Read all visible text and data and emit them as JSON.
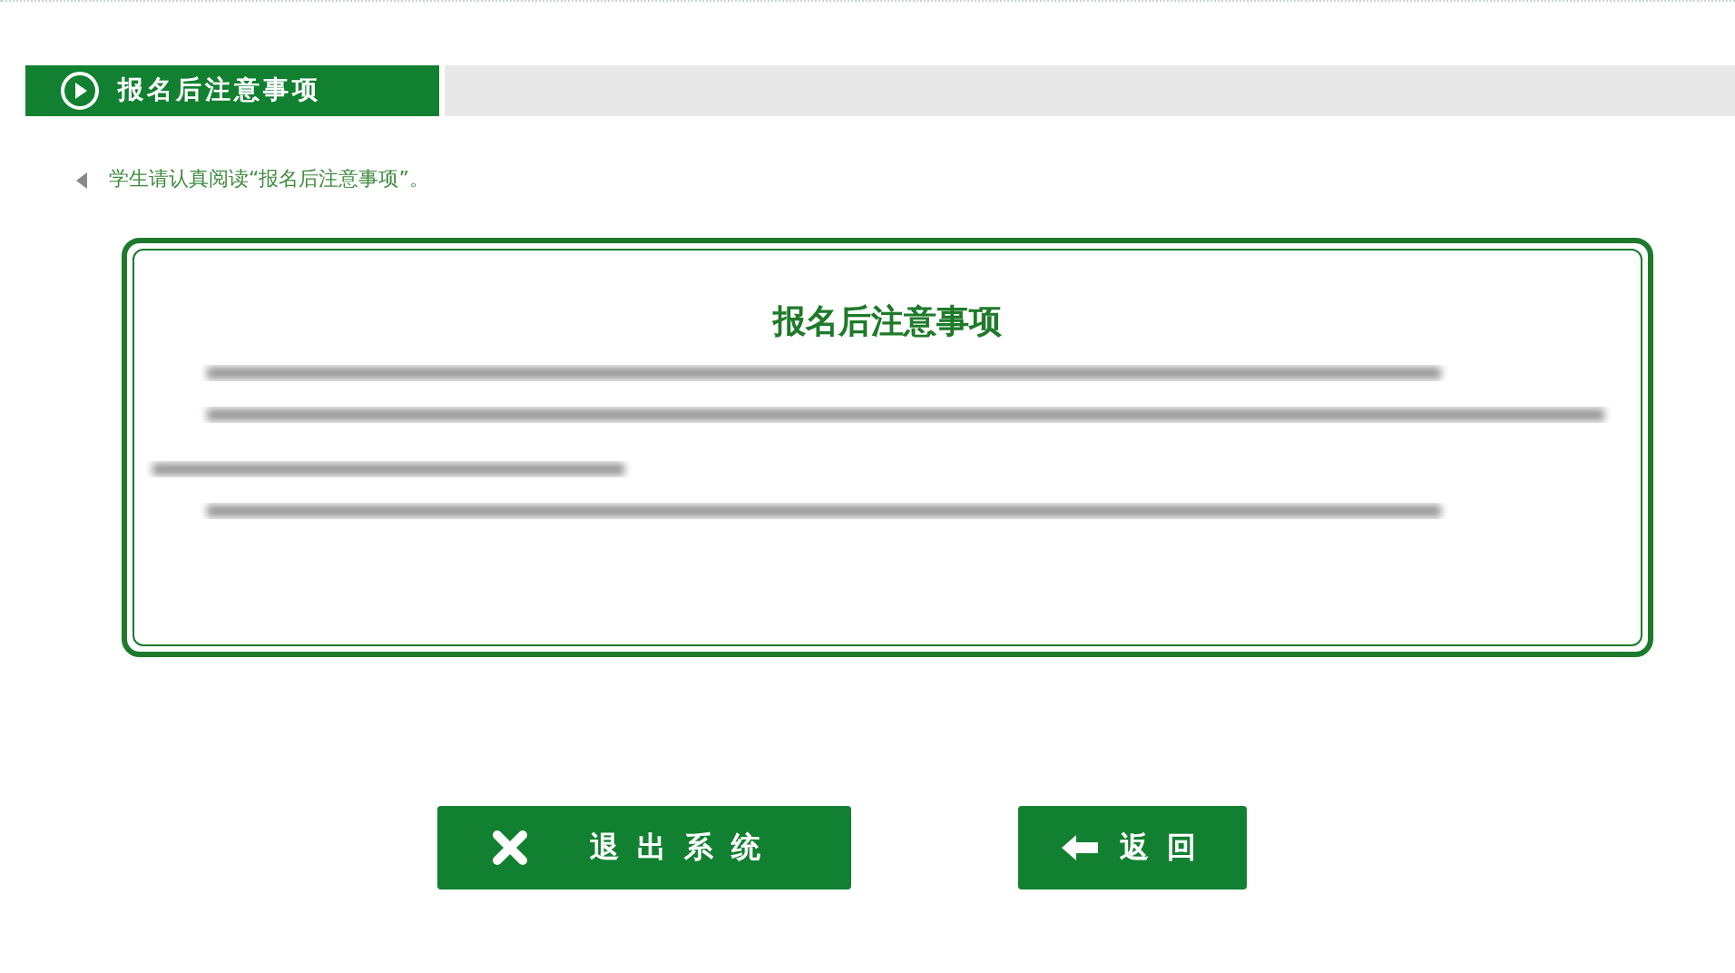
{
  "header": {
    "title": "报名后注意事项"
  },
  "hint": "学生请认真阅读“报名后注意事项”。",
  "notice": {
    "title": "报名后注意事项",
    "paragraphs": [
      {
        "kind": "blurred"
      },
      {
        "kind": "blurred_long"
      },
      {
        "kind": "blurred"
      }
    ]
  },
  "buttons": [
    {
      "label": "退出系统",
      "kind": "exit"
    },
    {
      "label": "返回",
      "kind": "back"
    }
  ]
}
